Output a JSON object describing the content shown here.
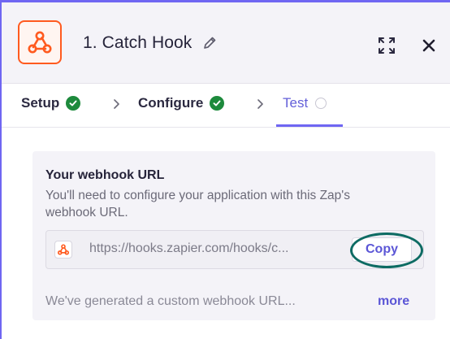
{
  "header": {
    "title": "1. Catch Hook",
    "icons": {
      "app": "webhook-icon",
      "edit": "pencil-icon",
      "expand": "expand-icon",
      "close": "close-icon"
    }
  },
  "steps": [
    {
      "label": "Setup",
      "status": "complete"
    },
    {
      "label": "Configure",
      "status": "complete"
    },
    {
      "label": "Test",
      "status": "current"
    }
  ],
  "webhook": {
    "heading": "Your webhook URL",
    "description": "You'll need to configure your application with this Zap's webhook URL.",
    "url": "https://hooks.zapier.com/hooks/c...",
    "copy_label": "Copy",
    "footer_text": "We've generated a custom webhook URL...",
    "more_label": "more"
  },
  "colors": {
    "accent": "#6f66f2",
    "brand_orange": "#ff5a1f",
    "success_green": "#1d8a3c",
    "link": "#5b56d6",
    "highlight_ring": "#0d6b63"
  }
}
